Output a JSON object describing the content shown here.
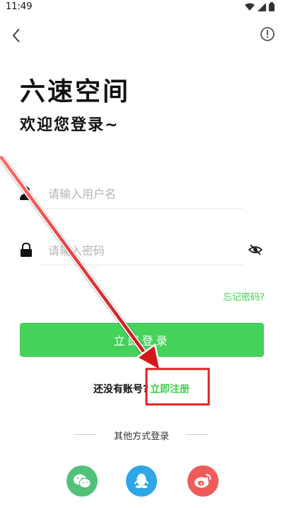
{
  "status": {
    "time": "11:49"
  },
  "app": {
    "title": "六速空间",
    "welcome": "欢迎您登录~"
  },
  "form": {
    "username_placeholder": "请输入用户名",
    "password_placeholder": "请输入密码",
    "forgot_label": "忘记密码?",
    "login_label": "立即登录"
  },
  "register": {
    "question": "还没有账号?",
    "link_label": "立即注册"
  },
  "other": {
    "label": "其他方式登录"
  },
  "colors": {
    "accent": "#44d25a",
    "link": "#3fcf4f",
    "wechat": "#52c27a",
    "qq": "#2fa6e6",
    "weibo": "#ef5b5b",
    "highlight": "#e02020"
  },
  "icons": [
    "back-icon",
    "info-icon",
    "user-icon",
    "lock-icon",
    "eye-off-icon",
    "wechat-icon",
    "qq-icon",
    "weibo-icon"
  ]
}
